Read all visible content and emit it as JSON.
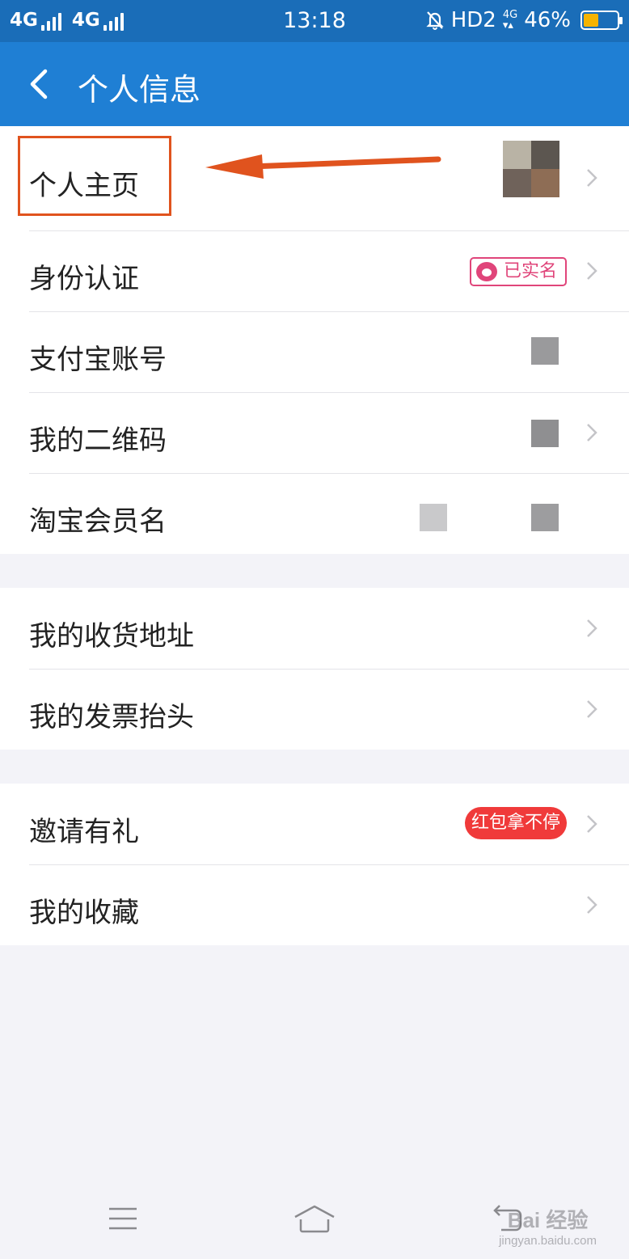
{
  "status_bar": {
    "network1": "4G",
    "network2": "4G",
    "time": "13:18",
    "hd": "HD2",
    "net_small": "4G",
    "battery_text": "46%",
    "battery_level": 0.46
  },
  "header": {
    "title": "个人信息"
  },
  "groups": [
    {
      "items": [
        {
          "label": "个人主页"
        },
        {
          "label": "身份认证",
          "badge": "已实名"
        },
        {
          "label": "支付宝账号"
        },
        {
          "label": "我的二维码"
        },
        {
          "label": "淘宝会员名"
        }
      ]
    },
    {
      "items": [
        {
          "label": "我的收货地址"
        },
        {
          "label": "我的发票抬头"
        }
      ]
    },
    {
      "items": [
        {
          "label": "邀请有礼",
          "badge": "红包拿不停"
        },
        {
          "label": "我的收藏"
        }
      ]
    }
  ],
  "watermark": {
    "main": "Bai 经验",
    "sub": "jingyan.baidu.com"
  },
  "colors": {
    "accent": "#1f7fd4",
    "highlight": "#e0531e",
    "badge_pink": "#e0457a",
    "badge_red": "#f03a3a"
  },
  "icons": [
    "back-arrow-icon",
    "chevron-right-icon",
    "menu-icon",
    "home-icon",
    "return-icon"
  ]
}
